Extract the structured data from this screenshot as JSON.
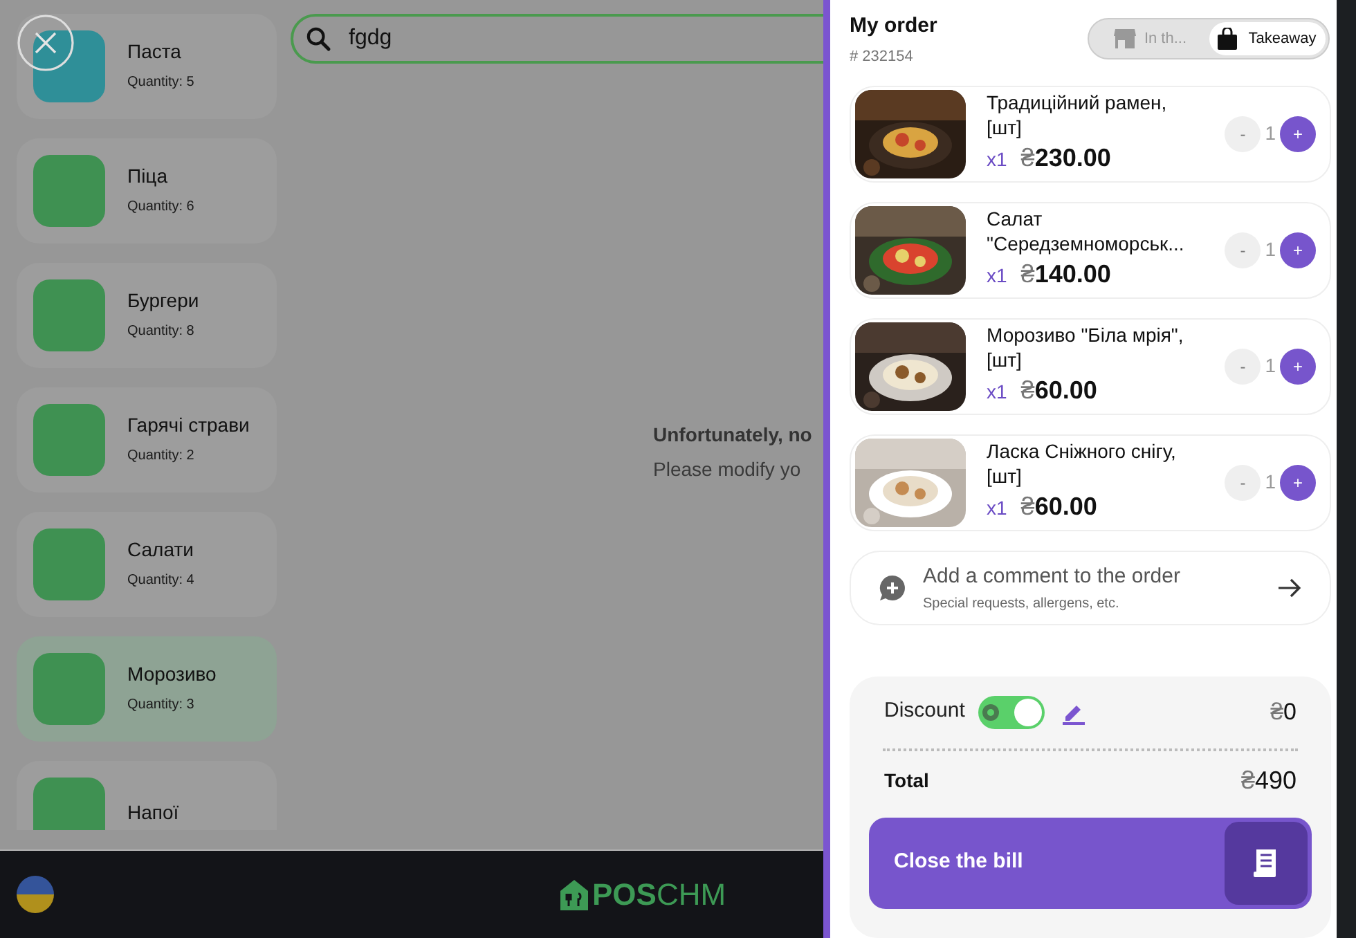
{
  "categories": [
    {
      "name": "Паста",
      "quantity": "Quantity: 5",
      "color": "#2f8f98",
      "selected": false
    },
    {
      "name": "Піца",
      "quantity": "Quantity: 6",
      "color": "#3f9152",
      "selected": false
    },
    {
      "name": "Бургери",
      "quantity": "Quantity: 8",
      "color": "#3f9152",
      "selected": false
    },
    {
      "name": "Гарячі страви",
      "quantity": "Quantity: 2",
      "color": "#3f9152",
      "selected": false
    },
    {
      "name": "Салати",
      "quantity": "Quantity: 4",
      "color": "#3f9152",
      "selected": false
    },
    {
      "name": "Морозиво",
      "quantity": "Quantity: 3",
      "color": "#3f9152",
      "selected": true
    },
    {
      "name": "Напої",
      "color": "#3f9152",
      "selected": false
    }
  ],
  "search": {
    "value": "fgdg"
  },
  "empty_message": {
    "title": "Unfortunately, no",
    "hint": "Please modify yo"
  },
  "footer": {
    "logo_bold": "POS",
    "logo_light": "CHM"
  },
  "order": {
    "title": "My order",
    "number": "# 232154",
    "modes": [
      {
        "label": "In th...",
        "kind": "dine-in",
        "selected": false
      },
      {
        "label": "Takeaway",
        "kind": "takeaway",
        "selected": true
      }
    ],
    "items": [
      {
        "name": "Традиційний рамен, [шт]",
        "multiplier": "x1",
        "currency": "₴",
        "amount": "230.00",
        "minus": "-",
        "quantity": "1",
        "plus": "+"
      },
      {
        "name": "Салат \"Середземноморськ...",
        "multiplier": "x1",
        "currency": "₴",
        "amount": "140.00",
        "minus": "-",
        "quantity": "1",
        "plus": "+"
      },
      {
        "name": "Морозиво \"Біла мрія\", [шт]",
        "multiplier": "x1",
        "currency": "₴",
        "amount": "60.00",
        "minus": "-",
        "quantity": "1",
        "plus": "+"
      },
      {
        "name": "Ласка Сніжного снігу, [шт]",
        "multiplier": "x1",
        "currency": "₴",
        "amount": "60.00",
        "minus": "-",
        "quantity": "1",
        "plus": "+"
      }
    ]
  },
  "comment": {
    "title": "Add a comment to the order",
    "hint": "Special requests, allergens, etc."
  },
  "summary": {
    "discount_label": "Discount",
    "discount_on": true,
    "discount_currency": "₴",
    "discount_amount": "0",
    "total_label": "Total",
    "total_currency": "₴",
    "total_amount": "490"
  },
  "close_bill": {
    "label": "Close the bill"
  }
}
